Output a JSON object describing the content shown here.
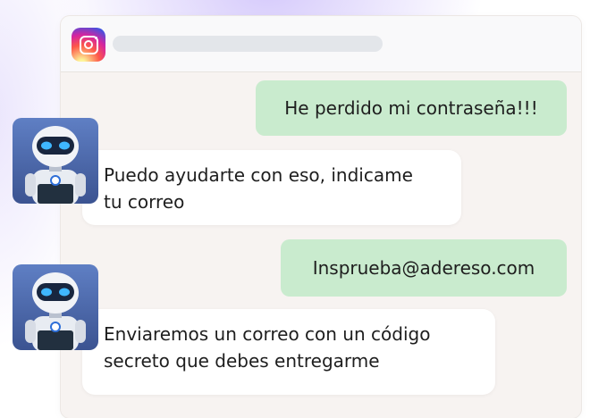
{
  "app": {
    "logo_icon": "instagram-icon",
    "accent": "#c9ebce"
  },
  "messages": [
    {
      "sender": "user",
      "text": "He perdido mi contraseña!!!"
    },
    {
      "sender": "bot",
      "avatar_icon": "robot-avatar-icon",
      "lines": [
        "Puedo ayudarte con eso, indicame",
        "tu correo"
      ]
    },
    {
      "sender": "user",
      "text": "Insprueba@adereso.com"
    },
    {
      "sender": "bot",
      "avatar_icon": "robot-avatar-icon",
      "lines": [
        "Enviaremos un correo con un código",
        "secreto que debes entregarme"
      ]
    }
  ]
}
